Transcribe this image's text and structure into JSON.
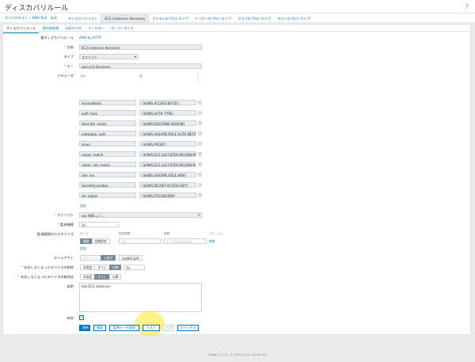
{
  "page": {
    "title": "ディスカバリルール",
    "help_icon": "?"
  },
  "breadcrumbs": [
    {
      "label": "すべてのホスト",
      "gray": false
    },
    {
      "label": "AWS Test",
      "gray": false
    },
    {
      "label": "有効",
      "gray": true
    }
  ],
  "nav_tabs": [
    {
      "label": "ディスカバリリスト",
      "active": false
    },
    {
      "label": "EC2 instances discovery",
      "active": true
    },
    {
      "label": "アイテムのプロトタイプ",
      "active": false
    },
    {
      "label": "トリガーのプロトタイプ",
      "active": false
    },
    {
      "label": "グラフのプロトタイプ",
      "active": false
    },
    {
      "label": "ホストのプロトタイプ",
      "active": false
    }
  ],
  "sub_tabs": [
    {
      "label": "ディスカバリルール",
      "active": true
    },
    {
      "label": "保存前処理",
      "active": false
    },
    {
      "label": "LLDマクロ",
      "active": false
    },
    {
      "label": "フィルター",
      "active": false
    },
    {
      "label": "オーバーライド",
      "active": false
    }
  ],
  "form": {
    "parent_label": "親ディスカバリルール",
    "parent_value": "AWS by HTTP",
    "name_label": "名前",
    "name_value": "EC2 instances discovery",
    "type_label": "タイプ",
    "type_value": "スクリプト",
    "key_label": "キー",
    "key_value": "aws.ec2.discovery",
    "params_label": "パラメータ",
    "params_col_name": "名前",
    "params_col_value": "値",
    "params_col_action": "アクション",
    "params_add": "追加",
    "script_label": "スクリプト",
    "script_value": "var AWS = {...",
    "interval_label": "監視間隔",
    "interval_value": "1h",
    "custom_intervals_label": "監視間隔のカスタマイズ",
    "ci_col_type": "タイプ",
    "ci_col_interval": "監視間隔",
    "ci_col_period": "期間",
    "ci_col_action": "アクション",
    "ci_seg_flexible": "柔軟",
    "ci_seg_scheduling": "定期設定",
    "ci_interval_placeholder": "50s",
    "ci_period_placeholder": "1-7,00:00-24:00",
    "ci_remove": "削除",
    "ci_add": "追加",
    "timeout_label": "タイムアウト",
    "timeout_seg": [
      "グローバル",
      "上書き"
    ],
    "timeout_value": "{$AWS.DAT",
    "delete_lost_label": "存在しなくなったデバイスの削除",
    "delete_lost_seg": [
      "未指定",
      "すぐに",
      "以降"
    ],
    "delete_lost_value": "7d",
    "disable_lost_label": "存在しなくなったデバイスの無効化",
    "disable_lost_seg": [
      "未指定",
      "すぐに",
      "以降"
    ],
    "description_label": "説明",
    "description_value": "Get EC2 instances",
    "enabled_label": "有効",
    "enabled_check": "✓"
  },
  "params": [
    {
      "name": "AccessKeyId",
      "value": "{$AWS.ACCESS.KEY.ID}"
    },
    {
      "name": "auth_type",
      "value": "{$AWS.AUTH_TYPE}"
    },
    {
      "name": "describe_region",
      "value": "{$AWS.DESCRIBE.REGION}"
    },
    {
      "name": "metadata_auth",
      "value": "{$AWS.ASSUME.ROLE.AUTH.META"
    },
    {
      "name": "proxy",
      "value": "{$AWS.PROXY}"
    },
    {
      "name": "region_match",
      "value": "{$AWS.EC2.LLD.FILTER.REGION.M"
    },
    {
      "name": "region_not_match",
      "value": "{$AWS.EC2.LLD.FILTER.REGION.N"
    },
    {
      "name": "role_arn",
      "value": "{$AWS.ASSUME.ROLE.ARN}"
    },
    {
      "name": "SecretAccessKey",
      "value": "{$AWS.SECRET.ACCESS.KEY}"
    },
    {
      "name": "sts_region",
      "value": "{$AWS.STS.REGION}"
    }
  ],
  "buttons": {
    "update": "更新",
    "clone": "複製",
    "check_now": "監視データ取得",
    "test": "テスト",
    "delete": "削除",
    "cancel": "キャンセル"
  },
  "footer": "Zabbix 7.0.22. © 2001–2025, Zabbix SIA"
}
